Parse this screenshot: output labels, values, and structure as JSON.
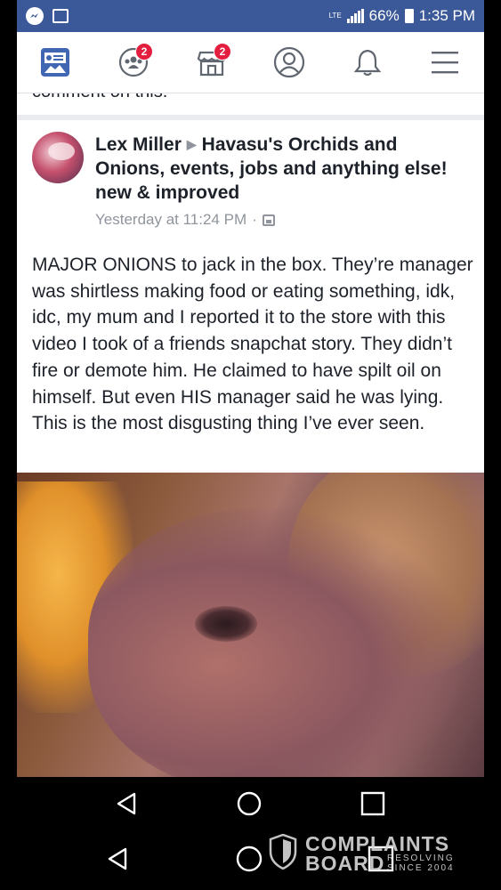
{
  "status_bar": {
    "network": "LTE",
    "battery": "66%",
    "time": "1:35 PM",
    "background_color": "#3b5998"
  },
  "nav": {
    "items": [
      {
        "name": "news-feed",
        "icon": "news-feed-icon",
        "badge": ""
      },
      {
        "name": "groups",
        "icon": "groups-icon",
        "badge": "2"
      },
      {
        "name": "marketplace",
        "icon": "marketplace-icon",
        "badge": "2"
      },
      {
        "name": "profile",
        "icon": "profile-icon",
        "badge": ""
      },
      {
        "name": "notifications",
        "icon": "bell-icon",
        "badge": ""
      },
      {
        "name": "menu",
        "icon": "hamburger-menu-icon",
        "badge": ""
      }
    ],
    "active_color": "#4267b2",
    "badge_color": "#e41e3f"
  },
  "previous_post": {
    "cut_off_text": "comment on this."
  },
  "post": {
    "author": "Lex Miller",
    "group": "Havasu's Orchids and Onions, events, jobs and anything else! new & improved",
    "timestamp": "Yesterday at 11:24 PM",
    "separator": "·",
    "body": "MAJOR ONIONS to jack in the box. They’re manager was shirtless making food or eating something, idk, idc, my mum and I reported it to the store with this video I took of a friends snapchat story. They didn’t fire or demote him. He claimed to have spilt oil on himself. But even HIS manager said he was lying. This is the most disgusting thing I’ve ever seen."
  },
  "watermark": {
    "line1": "COMPLAINTS",
    "line2": "BOARD",
    "tag1": "RESOLVING",
    "tag2": "SINCE 2004"
  }
}
